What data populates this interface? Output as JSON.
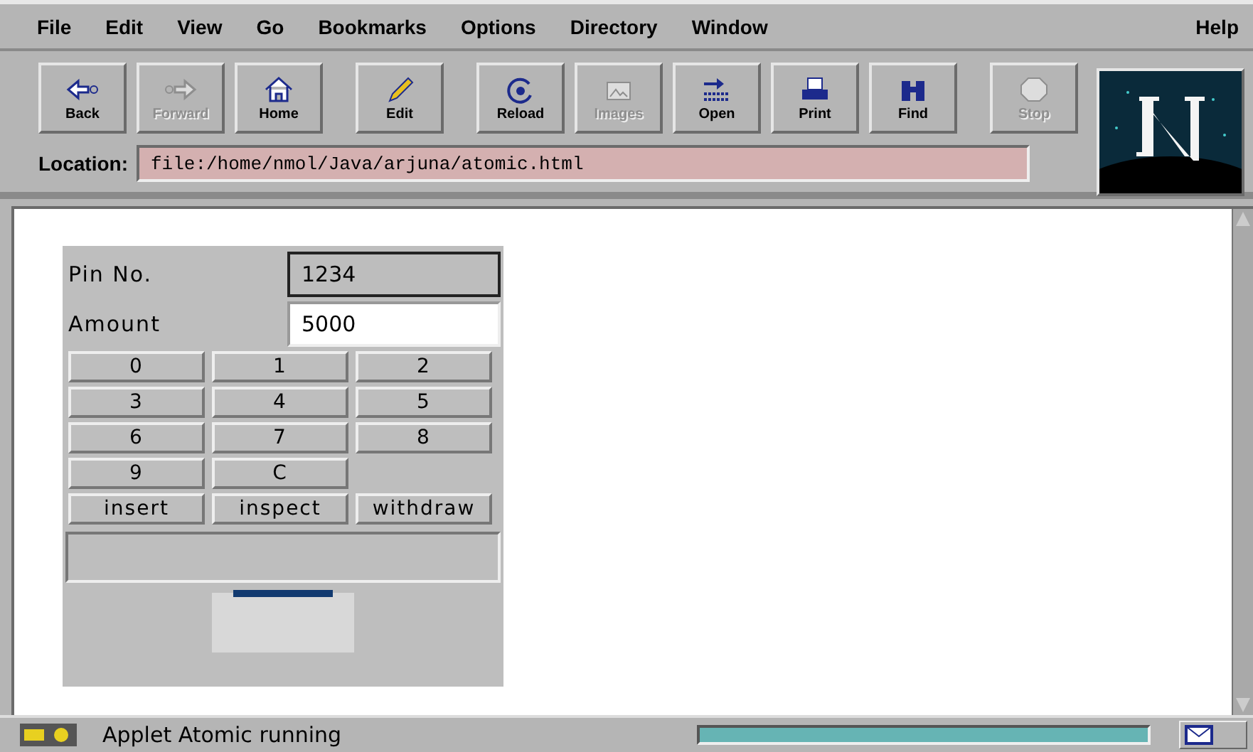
{
  "menu": [
    {
      "label": "File"
    },
    {
      "label": "Edit"
    },
    {
      "label": "View"
    },
    {
      "label": "Go"
    },
    {
      "label": "Bookmarks"
    },
    {
      "label": "Options"
    },
    {
      "label": "Directory"
    },
    {
      "label": "Window"
    }
  ],
  "help_menu": "Help",
  "toolbar": [
    {
      "label": "Back",
      "disabled": false
    },
    {
      "label": "Forward",
      "disabled": true
    },
    {
      "label": "Home",
      "disabled": false
    },
    {
      "label": "Edit",
      "disabled": false
    },
    {
      "label": "Reload",
      "disabled": false
    },
    {
      "label": "Images",
      "disabled": true
    },
    {
      "label": "Open",
      "disabled": false
    },
    {
      "label": "Print",
      "disabled": false
    },
    {
      "label": "Find",
      "disabled": false
    },
    {
      "label": "Stop",
      "disabled": true
    }
  ],
  "location": {
    "label": "Location:",
    "value": "file:/home/nmol/Java/arjuna/atomic.html"
  },
  "applet": {
    "pin": {
      "label": "Pin No.",
      "value": "1234"
    },
    "amount": {
      "label": "Amount",
      "value": "5000"
    },
    "keys": [
      "0",
      "1",
      "2",
      "3",
      "4",
      "5",
      "6",
      "7",
      "8",
      "9",
      "C"
    ],
    "actions": [
      "insert",
      "inspect",
      "withdraw"
    ]
  },
  "status": {
    "text": "Applet Atomic running",
    "level": 1
  }
}
